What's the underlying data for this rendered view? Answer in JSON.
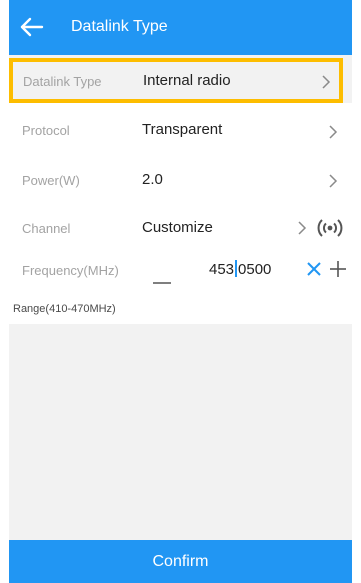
{
  "header": {
    "title": "Datalink Type",
    "back_icon": "arrow-left-icon"
  },
  "rows": {
    "datalink_type": {
      "label": "Datalink Type",
      "value": "Internal radio"
    },
    "protocol": {
      "label": "Protocol",
      "value": "Transparent"
    },
    "power": {
      "label": "Power(W)",
      "value": "2.0"
    },
    "channel": {
      "label": "Channel",
      "value": "Customize",
      "action_icon": "radio-signal-icon"
    },
    "frequency": {
      "label": "Frequency(MHz)",
      "value_integer": "453",
      "value_fraction": "0500",
      "value": "453.0500"
    }
  },
  "range_text": "Range(410-470MHz)",
  "confirm_label": "Confirm",
  "colors": {
    "primary": "#2196f3",
    "highlight_border": "#fdbd00",
    "background": "#f2f2f2"
  }
}
